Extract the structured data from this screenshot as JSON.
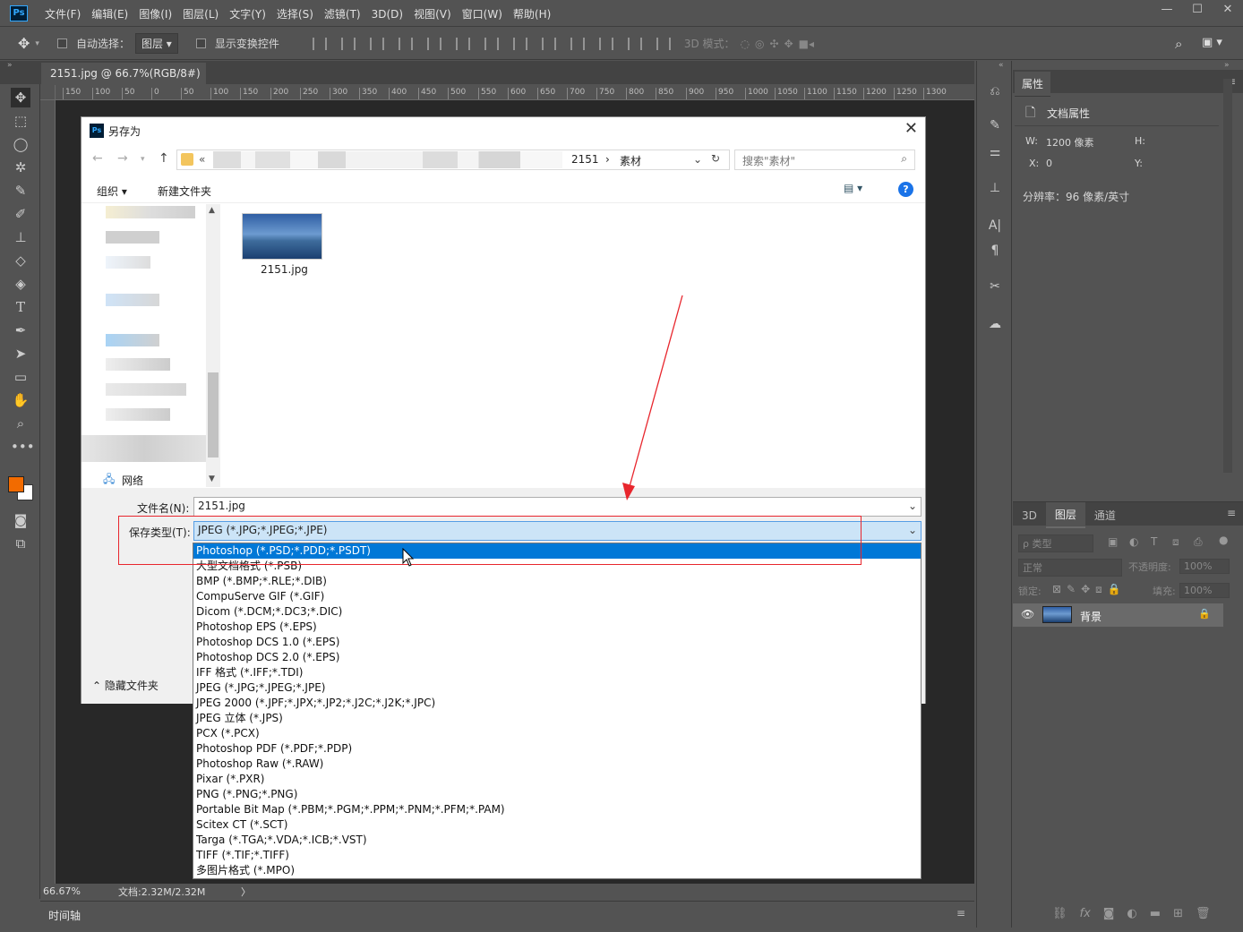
{
  "menubar": {
    "logo": "Ps",
    "items": [
      "文件(F)",
      "编辑(E)",
      "图像(I)",
      "图层(L)",
      "文字(Y)",
      "选择(S)",
      "滤镜(T)",
      "3D(D)",
      "视图(V)",
      "窗口(W)",
      "帮助(H)"
    ],
    "window_controls": [
      "—",
      "☐",
      "✕"
    ]
  },
  "options": {
    "auto_select_label": "自动选择：",
    "auto_select_value": "图层",
    "show_transform_label": "显示变换控件",
    "mode_3d_label": "3D 模式："
  },
  "document": {
    "tab_label": "2151.jpg @ 66.7%(RGB/8#)",
    "tab_close": "×",
    "ruler_ticks": [
      "150",
      "100",
      "50",
      "0",
      "50",
      "100",
      "150",
      "200",
      "250",
      "300",
      "350",
      "400",
      "450",
      "500",
      "550",
      "600",
      "650",
      "700",
      "750",
      "800",
      "850",
      "900",
      "950",
      "1000",
      "1050",
      "1100",
      "1150",
      "1200",
      "1250",
      "1300"
    ],
    "zoom": "66.67%",
    "doc_info": "文档:2.32M/2.32M",
    "status_arrow": "〉",
    "timeline_label": "时间轴"
  },
  "properties": {
    "tab": "属性",
    "doc_props": "文档属性",
    "w_label": "W:",
    "w_value": "1200 像素",
    "h_label": "H:",
    "x_label": "X:",
    "x_value": "0",
    "y_label": "Y:",
    "resolution": "分辨率：96 像素/英寸"
  },
  "layers": {
    "tabs": [
      "3D",
      "图层",
      "通道"
    ],
    "filter_label": "ρ 类型",
    "blend_mode": "正常",
    "opacity_label": "不透明度:",
    "opacity_value": "100%",
    "lock_label": "锁定:",
    "fill_label": "填充:",
    "fill_value": "100%",
    "layer_name": "背景"
  },
  "dialog": {
    "title": "另存为",
    "close": "✕",
    "path_prefix": "«",
    "path_folder": "2151",
    "path_sep": "›",
    "path_current": "素材",
    "search_placeholder": "搜索\"素材\"",
    "organize": "组织 ▾",
    "new_folder": "新建文件夹",
    "help": "?",
    "nav_network": "网络",
    "file_name": "2151.jpg",
    "filename_label": "文件名(N):",
    "filename_value": "2151.jpg",
    "type_label": "保存类型(T):",
    "type_value": "JPEG (*.JPG;*.JPEG;*.JPE)",
    "hide_folders": "隐藏文件夹"
  },
  "dropdown_options": [
    "Photoshop (*.PSD;*.PDD;*.PSDT)",
    "大型文档格式 (*.PSB)",
    "BMP (*.BMP;*.RLE;*.DIB)",
    "CompuServe GIF (*.GIF)",
    "Dicom (*.DCM;*.DC3;*.DIC)",
    "Photoshop EPS (*.EPS)",
    "Photoshop DCS 1.0 (*.EPS)",
    "Photoshop DCS 2.0 (*.EPS)",
    "IFF 格式 (*.IFF;*.TDI)",
    "JPEG (*.JPG;*.JPEG;*.JPE)",
    "JPEG 2000 (*.JPF;*.JPX;*.JP2;*.J2C;*.J2K;*.JPC)",
    "JPEG 立体 (*.JPS)",
    "PCX (*.PCX)",
    "Photoshop PDF (*.PDF;*.PDP)",
    "Photoshop Raw (*.RAW)",
    "Pixar (*.PXR)",
    "PNG (*.PNG;*.PNG)",
    "Portable Bit Map (*.PBM;*.PGM;*.PPM;*.PNM;*.PFM;*.PAM)",
    "Scitex CT (*.SCT)",
    "Targa (*.TGA;*.VDA;*.ICB;*.VST)",
    "TIFF (*.TIF;*.TIFF)",
    "多图片格式 (*.MPO)"
  ],
  "colors": {
    "ui_bg": "#535353",
    "canvas_bg": "#282828",
    "selection": "#0078d7",
    "annotation_red": "#e8262d",
    "foreground_swatch": "#f26b00"
  }
}
